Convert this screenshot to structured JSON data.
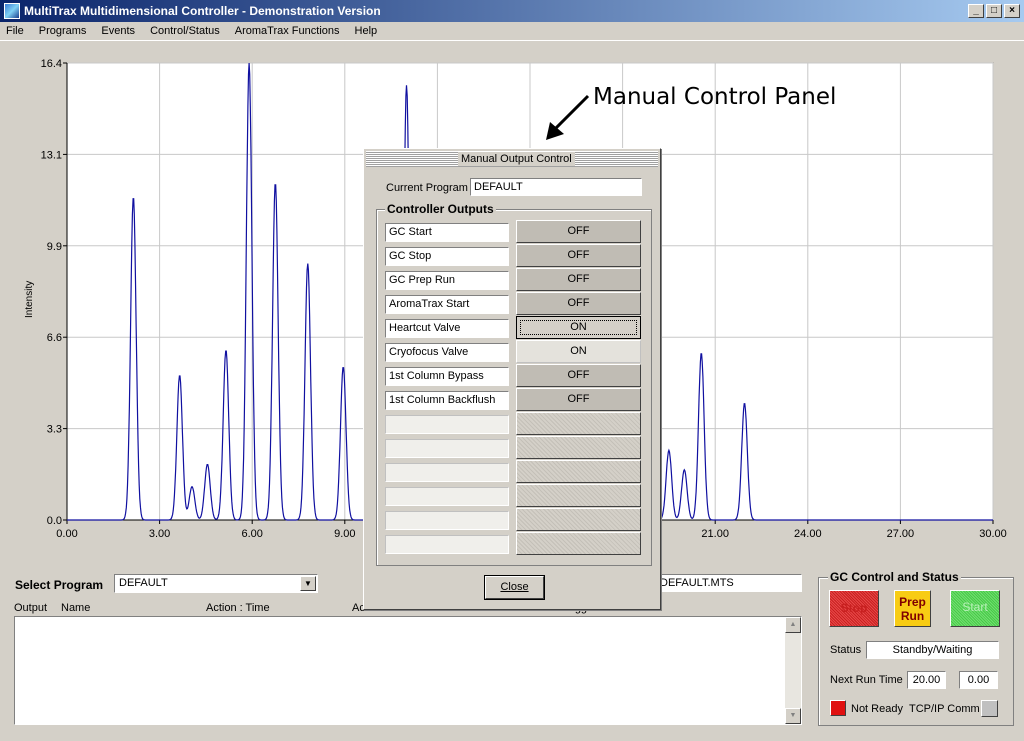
{
  "window": {
    "title": "MultiTrax Multidimensional Controller - Demonstration Version",
    "min": "_",
    "max": "□",
    "close": "×"
  },
  "menu": [
    "File",
    "Programs",
    "Events",
    "Control/Status",
    "AromaTrax Functions",
    "Help"
  ],
  "chart_data": {
    "type": "line",
    "ylabel": "Intensity",
    "xlabel": "",
    "xlim": [
      0,
      30
    ],
    "ylim": [
      0,
      16.4
    ],
    "xticks": [
      "0.00",
      "3.00",
      "6.00",
      "9.00",
      "12.00",
      "15.00",
      "18.00",
      "21.00",
      "24.00",
      "27.00",
      "30.00"
    ],
    "yticks": [
      "0.0",
      "3.3",
      "6.6",
      "9.9",
      "13.1",
      "16.4"
    ],
    "grid": true,
    "line_color": "#1010a0",
    "peaks": [
      {
        "x": 2.15,
        "y": 11.6
      },
      {
        "x": 3.65,
        "y": 5.2
      },
      {
        "x": 4.05,
        "y": 1.2
      },
      {
        "x": 4.55,
        "y": 2.0
      },
      {
        "x": 5.15,
        "y": 6.1
      },
      {
        "x": 5.9,
        "y": 16.4
      },
      {
        "x": 6.75,
        "y": 12.1
      },
      {
        "x": 7.8,
        "y": 9.2
      },
      {
        "x": 8.95,
        "y": 5.5
      },
      {
        "x": 11.0,
        "y": 15.6
      },
      {
        "x": 19.5,
        "y": 2.5
      },
      {
        "x": 20.0,
        "y": 1.8
      },
      {
        "x": 20.55,
        "y": 6.0
      },
      {
        "x": 21.95,
        "y": 4.2
      }
    ]
  },
  "annotation": "Manual Control Panel",
  "select_program": {
    "label": "Select Program",
    "value": "DEFAULT"
  },
  "filename": "DEFAULT.MTS",
  "grid_header": [
    "Output",
    "Name",
    "Action : Time",
    "Action : Time",
    "External Event Trigger"
  ],
  "gc": {
    "title": "GC Control and Status",
    "stop": "Stop",
    "prep": "Prep Run",
    "start": "Start",
    "status_label": "Status",
    "status_value": "Standby/Waiting",
    "next_run_label": "Next Run Time",
    "next_run_a": "20.00",
    "next_run_b": "0.00",
    "ready_text": "Not Ready",
    "tcp_text": "TCP/IP Comm"
  },
  "dialog": {
    "title": "Manual Output Control",
    "current_program_label": "Current Program",
    "current_program": "DEFAULT",
    "group_title": "Controller Outputs",
    "outputs": [
      {
        "name": "GC Start",
        "state": "OFF"
      },
      {
        "name": "GC Stop",
        "state": "OFF"
      },
      {
        "name": "GC Prep Run",
        "state": "OFF"
      },
      {
        "name": "AromaTrax Start",
        "state": "OFF"
      },
      {
        "name": "Heartcut Valve",
        "state": "ON"
      },
      {
        "name": "Cryofocus Valve",
        "state": "ON"
      },
      {
        "name": "1st Column Bypass",
        "state": "OFF"
      },
      {
        "name": "1st Column Backflush",
        "state": "OFF"
      }
    ],
    "empty_rows": 6,
    "close_label": "Close"
  }
}
